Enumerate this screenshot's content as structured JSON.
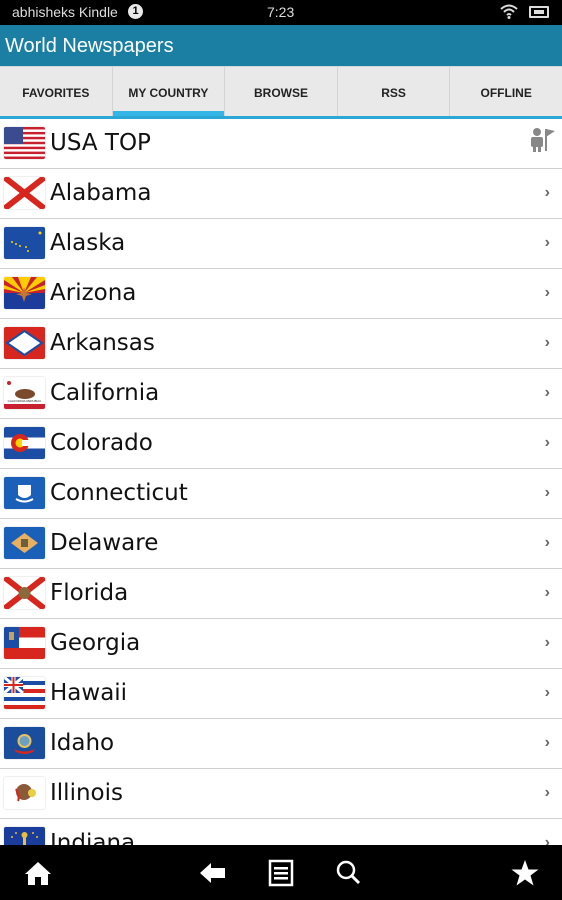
{
  "statusbar": {
    "device_name": "abhisheks Kindle",
    "notification_count": "1",
    "time": "7:23"
  },
  "app": {
    "title": "World Newspapers"
  },
  "tabs": [
    {
      "label": "FAVORITES",
      "active": false
    },
    {
      "label": "MY COUNTRY",
      "active": true
    },
    {
      "label": "BROWSE",
      "active": false
    },
    {
      "label": "RSS",
      "active": false
    },
    {
      "label": "OFFLINE",
      "active": false
    }
  ],
  "list": {
    "items": [
      {
        "name": "USA TOP",
        "flag": "usa",
        "trailing": "map-person-icon"
      },
      {
        "name": "Alabama",
        "flag": "alabama",
        "trailing": "chevron-right-icon"
      },
      {
        "name": "Alaska",
        "flag": "alaska",
        "trailing": "chevron-right-icon"
      },
      {
        "name": "Arizona",
        "flag": "arizona",
        "trailing": "chevron-right-icon"
      },
      {
        "name": "Arkansas",
        "flag": "arkansas",
        "trailing": "chevron-right-icon"
      },
      {
        "name": "California",
        "flag": "california",
        "trailing": "chevron-right-icon"
      },
      {
        "name": "Colorado",
        "flag": "colorado",
        "trailing": "chevron-right-icon"
      },
      {
        "name": "Connecticut",
        "flag": "connecticut",
        "trailing": "chevron-right-icon"
      },
      {
        "name": "Delaware",
        "flag": "delaware",
        "trailing": "chevron-right-icon"
      },
      {
        "name": "Florida",
        "flag": "florida",
        "trailing": "chevron-right-icon"
      },
      {
        "name": "Georgia",
        "flag": "georgia",
        "trailing": "chevron-right-icon"
      },
      {
        "name": "Hawaii",
        "flag": "hawaii",
        "trailing": "chevron-right-icon"
      },
      {
        "name": "Idaho",
        "flag": "idaho",
        "trailing": "chevron-right-icon"
      },
      {
        "name": "Illinois",
        "flag": "illinois",
        "trailing": "chevron-right-icon"
      },
      {
        "name": "Indiana",
        "flag": "indiana",
        "trailing": "chevron-right-icon"
      }
    ],
    "chevron_glyph": "›"
  },
  "navbar": {
    "buttons": [
      "home",
      "back",
      "menu",
      "search",
      "favorites"
    ]
  },
  "colors": {
    "title_bar": "#1b7fa3",
    "tab_indicator": "#33b5e5",
    "tab_background": "#e9e9e9"
  }
}
